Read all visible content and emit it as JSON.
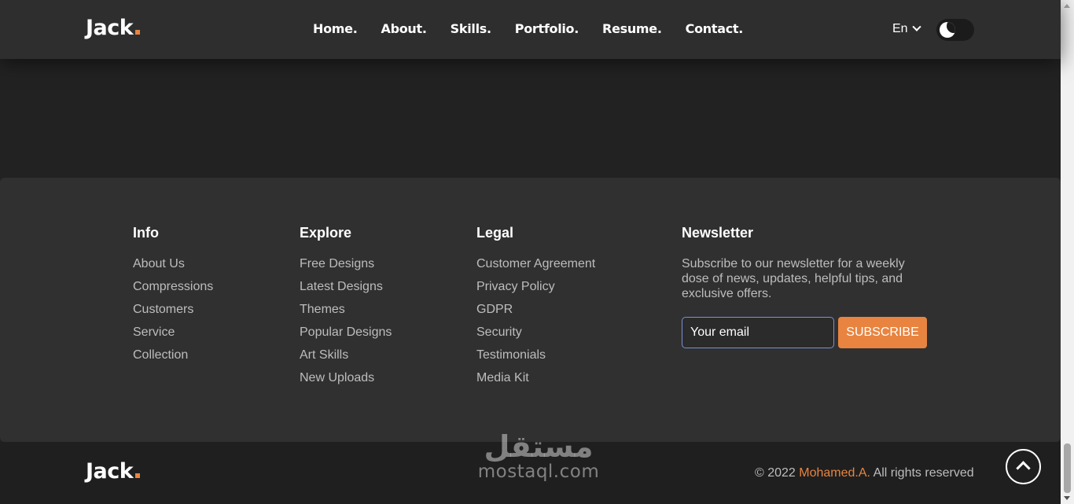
{
  "header": {
    "logo": "Jack",
    "nav": [
      "Home.",
      "About.",
      "Skills.",
      "Portfolio.",
      "Resume.",
      "Contact."
    ],
    "language": "En",
    "theme_toggle_icon": "moon-icon"
  },
  "footer": {
    "info": {
      "title": "Info",
      "links": [
        "About Us",
        "Compressions",
        "Customers",
        "Service",
        "Collection"
      ]
    },
    "explore": {
      "title": "Explore",
      "links": [
        "Free Designs",
        "Latest Designs",
        "Themes",
        "Popular Designs",
        "Art Skills",
        "New Uploads"
      ]
    },
    "legal": {
      "title": "Legal",
      "links": [
        "Customer Agreement",
        "Privacy Policy",
        "GDPR",
        "Security",
        "Testimonials",
        "Media Kit"
      ]
    },
    "newsletter": {
      "title": "Newsletter",
      "text": "Subscribe to our newsletter for a weekly dose of news, updates, helpful tips, and exclusive offers.",
      "email_placeholder": "Your email",
      "button": "SUBSCRIBE"
    }
  },
  "bottom": {
    "logo": "Jack",
    "watermark_arabic": "مستقل",
    "watermark_latin": "mostaql.com",
    "copyright_prefix": "© 2022",
    "author": "Mohamed.A.",
    "copyright_suffix": "All rights reserved",
    "to_top_icon": "chevron-up-icon"
  },
  "colors": {
    "accent": "#e8843f",
    "background": "#222222",
    "card": "#303030",
    "header": "#2e2e2e"
  }
}
